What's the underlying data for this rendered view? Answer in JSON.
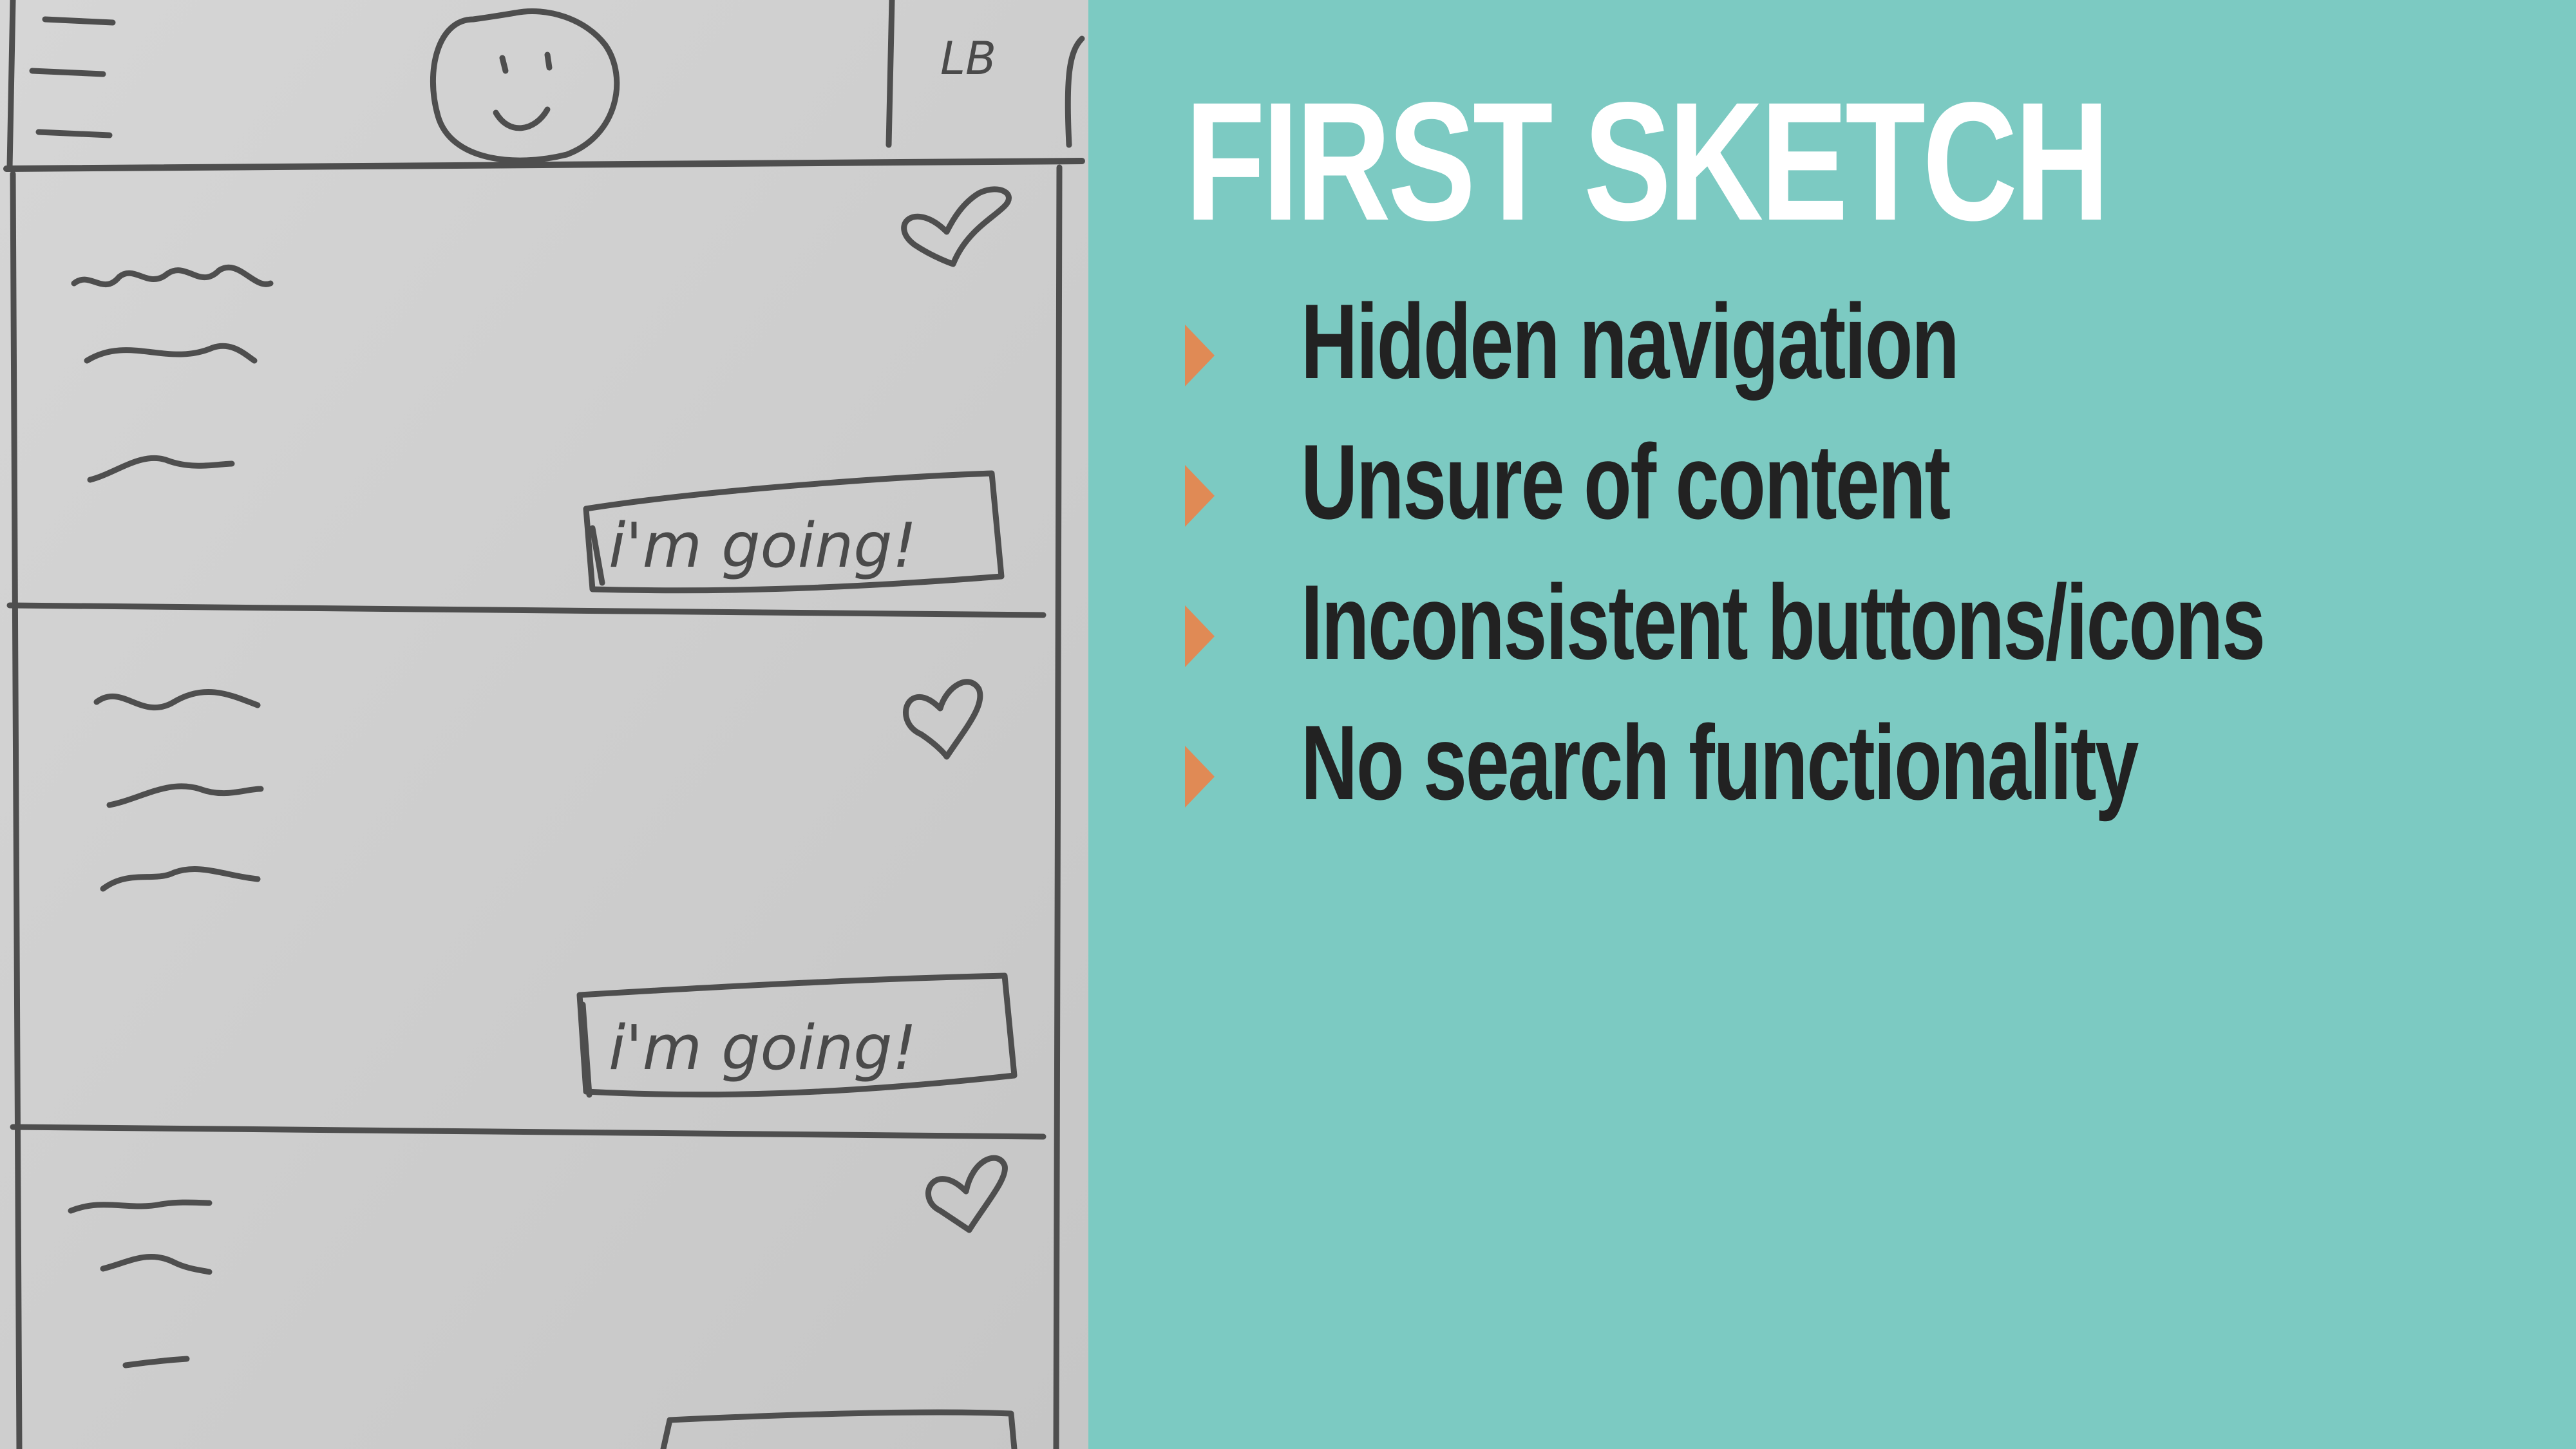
{
  "slide": {
    "title": "FIRST SKETCH",
    "bullets": [
      "Hidden navigation",
      "Unsure of content",
      "Inconsistent buttons/icons",
      "No search functionality"
    ]
  },
  "sketch": {
    "header_initials": "LB",
    "button_label": "i'm going!",
    "cards": 3
  },
  "colors": {
    "background": "#7ccac2",
    "title": "#ffffff",
    "bullet_text": "#222222",
    "bullet_icon": "#e08a55",
    "paper": "#cfcfcf",
    "pencil": "#555555"
  }
}
